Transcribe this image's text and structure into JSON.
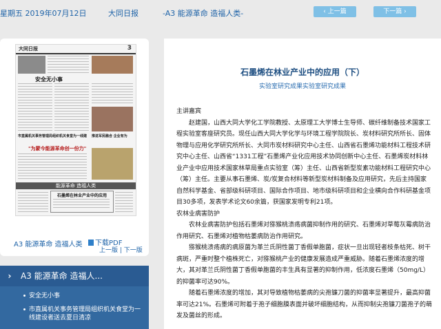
{
  "topbar": {
    "date": "星期五 2019年07月12日",
    "paper": "大同日报",
    "section": "-A3 能源革命 造福人类-",
    "prev": "上一篇",
    "next": "下一篇"
  },
  "left_panel": {
    "thumbnail": {
      "logo": "大同日报",
      "page_number": "3",
      "headlines": [
        "安全无小事",
        "市直属机关事务管理局组织机关食堂为一线建设者送去夏日清凉",
        "\"为蒙今能源革命创一份力\"",
        "石墨烯在林业产业中的应用",
        "推进军民融合 企业有为",
        "能源革命 造福人类"
      ]
    },
    "caption": "A3 能源革命 造福人类",
    "pdf": "下载PDF",
    "page_nav": "上一版 | 下一版"
  },
  "section_box": {
    "heading": "A3 能源革命 造福人...",
    "items": [
      "安全无小事",
      "市直属机关事务管理局组织机关食堂为一线建设者送去夏日清凉"
    ]
  },
  "article": {
    "title": "石墨烯在林业产业中的应用（下）",
    "subtitle": "实验室研究成果实验室研究成果",
    "paragraphs": [
      {
        "type": "h",
        "text": "主讲嘉宾"
      },
      {
        "type": "t",
        "text": "赵建国，山西大同大学化工学院教授、太原理工大学博士生导师、碳纤维制备技术国家工程实验室客座研究员。现任山西大同大学化学与环境工程学院院长、炭材料研究所所长、固体物理与应用化学研究所所长、大同市炭材料研究中心主任、山西省石墨烯功能材料工程技术研究中心主任、山西省“1331工程”石墨烯产业化应用技术协同创新中心主任、石墨烯炭材料林业产业中应用技术国家林草局重点实验室（筹）主任、山西省新型炭素功能材料工程研究中心（筹）主任。主要从事石墨烯、炭/炭复合材料等新型炭材料制备及应用研究，先后主持国家自然科学基金、省部级科研项目、国际合作项目、地市级科研项目和企业横向合作科研基金项目30多项，发表学术论文60余篇，获国家发明专利21项。"
      },
      {
        "type": "h",
        "text": "农林业病害防护"
      },
      {
        "type": "t",
        "text": "农林业病害防护包括石墨烯对猕猴桃溃疡病菌抑制作用的研究、石墨烯对草莓灰霉病防治作用研究、石墨烯对植物枯萎病防治作用研究。"
      },
      {
        "type": "t",
        "text": "猕猴桃溃疡病的病原菌为革兰氏阴性菌丁香假单胞菌，症状一旦出现轻者枝条枯死、树干病斑，严重时整个植株死亡，对猕猴桃产业的健康发展造成严重威胁。随着石墨烯浓度的增大，其对革兰氏阴性菌丁香假单胞菌的丰生具有显著的抑制作用，低浓度石墨烯（50mg/L）的抑菌率可达90%。"
      },
      {
        "type": "t",
        "text": "随着石墨烯浓度的增加，其对导致植物枯萎病的尖孢镰刀菌的抑菌率显著提升，最高抑菌率可达21%。石墨烯可附着于孢子细胞膜表面并破坏细胞结构，从而抑制尖孢镰刀菌孢子的萌发及菌丝的形成。"
      }
    ]
  }
}
